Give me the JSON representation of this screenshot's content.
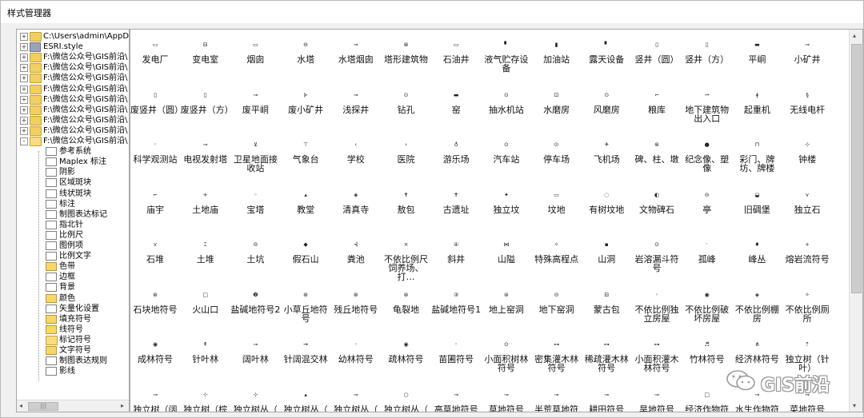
{
  "window": {
    "title": "样式管理器"
  },
  "tree": {
    "rows": [
      {
        "label": "C:\\Users\\admin\\AppData",
        "type": "folder",
        "level": 0,
        "expander": "+"
      },
      {
        "label": "ESRI.style",
        "type": "style",
        "level": 0,
        "expander": "+"
      },
      {
        "label": "F:\\微信公众号\\GIS前沿\\",
        "type": "folder",
        "level": 0,
        "expander": "+"
      },
      {
        "label": "F:\\微信公众号\\GIS前沿\\",
        "type": "folder",
        "level": 0,
        "expander": "+"
      },
      {
        "label": "F:\\微信公众号\\GIS前沿\\",
        "type": "folder",
        "level": 0,
        "expander": "+"
      },
      {
        "label": "F:\\微信公众号\\GIS前沿\\",
        "type": "folder",
        "level": 0,
        "expander": "+"
      },
      {
        "label": "F:\\微信公众号\\GIS前沿\\",
        "type": "folder",
        "level": 0,
        "expander": "+"
      },
      {
        "label": "F:\\微信公众号\\GIS前沿\\",
        "type": "folder",
        "level": 0,
        "expander": "+"
      },
      {
        "label": "F:\\微信公众号\\GIS前沿\\",
        "type": "folder",
        "level": 0,
        "expander": "+"
      },
      {
        "label": "F:\\微信公众号\\GIS前沿\\",
        "type": "folder",
        "level": 0,
        "expander": "+"
      },
      {
        "label": "F:\\微信公众号\\GIS前沿\\",
        "type": "folder-open",
        "level": 0,
        "expander": "-"
      },
      {
        "label": "参考系统",
        "type": "item",
        "level": 1
      },
      {
        "label": "Maplex 标注",
        "type": "item",
        "level": 1
      },
      {
        "label": "阴影",
        "type": "item",
        "level": 1
      },
      {
        "label": "区域斑块",
        "type": "item",
        "level": 1
      },
      {
        "label": "线状斑块",
        "type": "item",
        "level": 1
      },
      {
        "label": "标注",
        "type": "item",
        "level": 1
      },
      {
        "label": "制图表达标记",
        "type": "item",
        "level": 1
      },
      {
        "label": "指北针",
        "type": "item",
        "level": 1
      },
      {
        "label": "比例尺",
        "type": "item",
        "level": 1
      },
      {
        "label": "图例项",
        "type": "item",
        "level": 1
      },
      {
        "label": "比例文字",
        "type": "item",
        "level": 1
      },
      {
        "label": "色带",
        "type": "item-yellow",
        "level": 1
      },
      {
        "label": "边框",
        "type": "item",
        "level": 1
      },
      {
        "label": "背景",
        "type": "item",
        "level": 1
      },
      {
        "label": "颜色",
        "type": "item-yellow",
        "level": 1
      },
      {
        "label": "矢量化设置",
        "type": "item",
        "level": 1
      },
      {
        "label": "填充符号",
        "type": "item-yellow",
        "level": 1
      },
      {
        "label": "线符号",
        "type": "item-yellow",
        "level": 1
      },
      {
        "label": "标记符号",
        "type": "folder-open",
        "level": 1
      },
      {
        "label": "文字符号",
        "type": "item-yellow",
        "level": 1
      },
      {
        "label": "制图表达规则",
        "type": "item",
        "level": 1
      },
      {
        "label": "影线",
        "type": "item",
        "level": 1
      }
    ],
    "scroll_left": "◂",
    "scroll_right": "▸",
    "scroll_thumb": "|||"
  },
  "symbols": {
    "rows": [
      [
        {
          "label": "发电厂",
          "glyph": "▭"
        },
        {
          "label": "变电室",
          "glyph": "⊟"
        },
        {
          "label": "烟囱",
          "glyph": "▭"
        },
        {
          "label": "水塔",
          "glyph": "⊖"
        },
        {
          "label": "水塔烟囱",
          "glyph": "⊸"
        },
        {
          "label": "塔形建筑物",
          "glyph": "⊗"
        },
        {
          "label": "石油井",
          "glyph": "▭"
        },
        {
          "label": "液气贮存设备",
          "glyph": "▘"
        },
        {
          "label": "加油站",
          "glyph": "▮"
        },
        {
          "label": "露天设备",
          "glyph": "▘"
        },
        {
          "label": "竖井（圆）",
          "glyph": "▯"
        },
        {
          "label": "竖井（方）",
          "glyph": "▯"
        },
        {
          "label": "平峒",
          "glyph": "▬"
        },
        {
          "label": "小矿井",
          "glyph": "⊸"
        }
      ],
      [
        {
          "label": "废竖井（圆）",
          "glyph": "▯"
        },
        {
          "label": "废竖井（方）",
          "glyph": "▯"
        },
        {
          "label": "废平峒",
          "glyph": "⊸"
        },
        {
          "label": "废小矿井",
          "glyph": "⊱"
        },
        {
          "label": "浅探井",
          "glyph": "⊸"
        },
        {
          "label": "钻孔",
          "glyph": "⊙"
        },
        {
          "label": "窑",
          "glyph": "▬"
        },
        {
          "label": "抽水机站",
          "glyph": "⊙"
        },
        {
          "label": "水磨房",
          "glyph": "⊡"
        },
        {
          "label": "风磨房",
          "glyph": "⊙"
        },
        {
          "label": "粮库",
          "glyph": "⌐"
        },
        {
          "label": "地下建筑物出入口",
          "glyph": "⇀"
        },
        {
          "label": "起重机",
          "glyph": "ǂ"
        },
        {
          "label": "无线电杆",
          "glyph": "§"
        }
      ],
      [
        {
          "label": "科学观测站",
          "glyph": "◦"
        },
        {
          "label": "电视发射塔",
          "glyph": "⊸"
        },
        {
          "label": "卫星地面接收站",
          "glyph": "⊻"
        },
        {
          "label": "气象台",
          "glyph": "⊤"
        },
        {
          "label": "学校",
          "glyph": "‹"
        },
        {
          "label": "医院",
          "glyph": "›"
        },
        {
          "label": "游乐场",
          "glyph": "♁"
        },
        {
          "label": "汽车站",
          "glyph": "⊙"
        },
        {
          "label": "停车场",
          "glyph": "⊙"
        },
        {
          "label": "飞机场",
          "glyph": "✈"
        },
        {
          "label": "碑、柱、墩",
          "glyph": "⊛"
        },
        {
          "label": "纪念像、塑像",
          "glyph": "●"
        },
        {
          "label": "彩门、牌坊、牌楼",
          "glyph": "⊓"
        },
        {
          "label": "钟楼",
          "glyph": "⊹"
        }
      ],
      [
        {
          "label": "庙宇",
          "glyph": "⌐"
        },
        {
          "label": "土地庙",
          "glyph": "+"
        },
        {
          "label": "宝塔",
          "glyph": "◦"
        },
        {
          "label": "教堂",
          "glyph": "▴"
        },
        {
          "label": "清真寺",
          "glyph": "◈"
        },
        {
          "label": "敖包",
          "glyph": "✝"
        },
        {
          "label": "古遗址",
          "glyph": "✝"
        },
        {
          "label": "独立坟",
          "glyph": "✦"
        },
        {
          "label": "坟地",
          "glyph": "▭"
        },
        {
          "label": "有树坟地",
          "glyph": "◌"
        },
        {
          "label": "文物碑石",
          "glyph": "◐"
        },
        {
          "label": "亭",
          "glyph": "⊝"
        },
        {
          "label": "旧碉堡",
          "glyph": "◒"
        },
        {
          "label": "独立石",
          "glyph": "⋎"
        }
      ],
      [
        {
          "label": "石堆",
          "glyph": "⋎"
        },
        {
          "label": "土堆",
          "glyph": "⌶"
        },
        {
          "label": "土坑",
          "glyph": "⊝"
        },
        {
          "label": "假石山",
          "glyph": "◆"
        },
        {
          "label": "粪池",
          "glyph": "⊰"
        },
        {
          "label": "不依比例尺饲养场、打…",
          "glyph": "×"
        },
        {
          "label": "斜井",
          "glyph": "④"
        },
        {
          "label": "山隘",
          "glyph": "⋈"
        },
        {
          "label": "特殊高程点",
          "glyph": "✧"
        },
        {
          "label": "山洞",
          "glyph": "▪"
        },
        {
          "label": "岩溶漏斗符号",
          "glyph": "⊙"
        },
        {
          "label": "孤峰",
          "glyph": "ˑ"
        },
        {
          "label": "峰丛",
          "glyph": "♦"
        },
        {
          "label": "熔岩流符号",
          "glyph": "⋄"
        }
      ],
      [
        {
          "label": "石块地符号",
          "glyph": "⊛"
        },
        {
          "label": "火山口",
          "glyph": "□"
        },
        {
          "label": "盐碱地符号2",
          "glyph": "❷"
        },
        {
          "label": "小草丘地符号",
          "glyph": "⊛"
        },
        {
          "label": "残丘地符号",
          "glyph": "⊛"
        },
        {
          "label": "龟裂地",
          "glyph": "⊛"
        },
        {
          "label": "盐碱地符号1",
          "glyph": "③"
        },
        {
          "label": "地上窑洞",
          "glyph": "⊜"
        },
        {
          "label": "地下窑洞",
          "glyph": "⊝"
        },
        {
          "label": "蒙古包",
          "glyph": "⊟"
        },
        {
          "label": "不依比例独立房屋",
          "glyph": "◦"
        },
        {
          "label": "不依比例破坏房屋",
          "glyph": "◉"
        },
        {
          "label": "不依比例棚房",
          "glyph": "◈"
        },
        {
          "label": "不依比例厕所",
          "glyph": "✧"
        }
      ],
      [
        {
          "label": "成林符号",
          "glyph": "◉"
        },
        {
          "label": "针叶林",
          "glyph": "↟"
        },
        {
          "label": "阔叶林",
          "glyph": "⊸"
        },
        {
          "label": "针阔混交林",
          "glyph": "⇝"
        },
        {
          "label": "幼林符号",
          "glyph": "◦"
        },
        {
          "label": "疏林符号",
          "glyph": "◉"
        },
        {
          "label": "苗圃符号",
          "glyph": "◦"
        },
        {
          "label": "小面积树林符号",
          "glyph": "⊙"
        },
        {
          "label": "密集灌木林符号",
          "glyph": "⊶"
        },
        {
          "label": "稀疏灌木林符号",
          "glyph": "⊶"
        },
        {
          "label": "小面积灌木林符号",
          "glyph": "⊶"
        },
        {
          "label": "竹林符号",
          "glyph": "♬"
        },
        {
          "label": "经济林符号",
          "glyph": "⋔"
        },
        {
          "label": "独立树（针叶）",
          "glyph": "⇡"
        }
      ],
      [
        {
          "label": "独立树（阔",
          "glyph": "⊸"
        },
        {
          "label": "独立树（棕",
          "glyph": "⊹"
        },
        {
          "label": "独立树丛（",
          "glyph": "⊹"
        },
        {
          "label": "独立树丛（",
          "glyph": "▴"
        },
        {
          "label": "独立树丛（",
          "glyph": "⊸"
        },
        {
          "label": "独立树丛（",
          "glyph": "○"
        },
        {
          "label": "高草地符号",
          "glyph": "⊸"
        },
        {
          "label": "草地符号",
          "glyph": "⊸"
        },
        {
          "label": "半荒草地符",
          "glyph": "⊸"
        },
        {
          "label": "耕田符号",
          "glyph": "⊸"
        },
        {
          "label": "旱地符号",
          "glyph": "⊸"
        },
        {
          "label": "经济作物符",
          "glyph": "□"
        },
        {
          "label": "水生作物符",
          "glyph": "⊸"
        },
        {
          "label": "菜地符号",
          "glyph": "⊸"
        }
      ]
    ]
  },
  "watermark": {
    "text": "GIS前沿"
  }
}
